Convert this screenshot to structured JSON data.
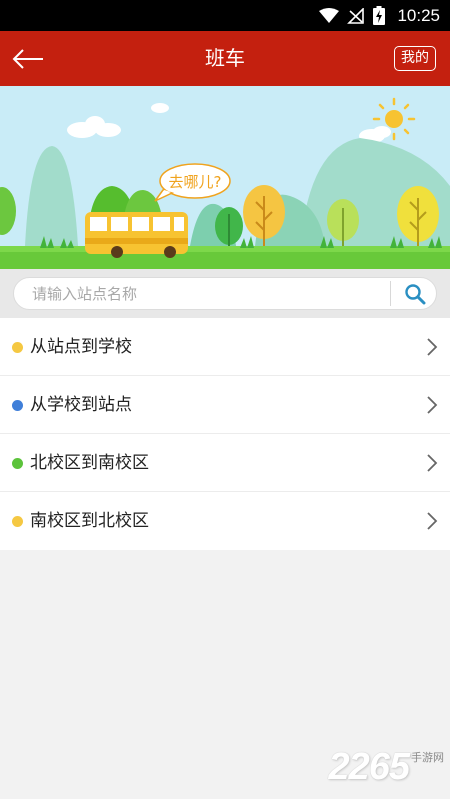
{
  "status_bar": {
    "time": "10:25",
    "icons": [
      "wifi-icon",
      "signal-off-icon",
      "battery-charging-icon"
    ]
  },
  "nav": {
    "back_icon": "back-arrow-icon",
    "title": "班车",
    "mine_label": "我的"
  },
  "banner": {
    "bubble_text": "去哪儿?"
  },
  "search": {
    "placeholder": "请输入站点名称",
    "value": "",
    "button_icon": "search-icon"
  },
  "routes": [
    {
      "label": "从站点到学校",
      "dot_color": "#f5c842"
    },
    {
      "label": "从学校到站点",
      "dot_color": "#3f7fd9"
    },
    {
      "label": "北校区到南校区",
      "dot_color": "#5cc33b"
    },
    {
      "label": "南校区到北校区",
      "dot_color": "#f5c842"
    }
  ],
  "colors": {
    "accent": "#c4200f",
    "search_icon": "#2a8fc2"
  },
  "watermark": {
    "number": "2265",
    "text": "手游网"
  }
}
